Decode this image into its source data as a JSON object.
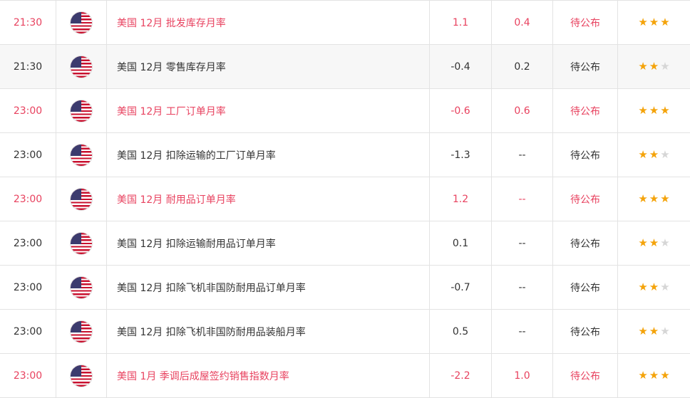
{
  "rows": [
    {
      "time": "21:30",
      "event": "美国 12月 批发库存月率",
      "previous": "1.1",
      "forecast": "0.4",
      "actual": "待公布",
      "stars": 3
    },
    {
      "time": "21:30",
      "event": "美国 12月 零售库存月率",
      "previous": "-0.4",
      "forecast": "0.2",
      "actual": "待公布",
      "stars": 2
    },
    {
      "time": "23:00",
      "event": "美国 12月 工厂订单月率",
      "previous": "-0.6",
      "forecast": "0.6",
      "actual": "待公布",
      "stars": 3
    },
    {
      "time": "23:00",
      "event": "美国 12月 扣除运输的工厂订单月率",
      "previous": "-1.3",
      "forecast": "--",
      "actual": "待公布",
      "stars": 2
    },
    {
      "time": "23:00",
      "event": "美国 12月 耐用品订单月率",
      "previous": "1.2",
      "forecast": "--",
      "actual": "待公布",
      "stars": 3
    },
    {
      "time": "23:00",
      "event": "美国 12月 扣除运输耐用品订单月率",
      "previous": "0.1",
      "forecast": "--",
      "actual": "待公布",
      "stars": 2
    },
    {
      "time": "23:00",
      "event": "美国 12月 扣除飞机非国防耐用品订单月率",
      "previous": "-0.7",
      "forecast": "--",
      "actual": "待公布",
      "stars": 2
    },
    {
      "time": "23:00",
      "event": "美国 12月 扣除飞机非国防耐用品装船月率",
      "previous": "0.5",
      "forecast": "--",
      "actual": "待公布",
      "stars": 2
    },
    {
      "time": "23:00",
      "event": "美国 1月 季调后成屋签约销售指数月率",
      "previous": "-2.2",
      "forecast": "1.0",
      "actual": "待公布",
      "stars": 3
    }
  ],
  "colors": {
    "highlight": "#e8425f",
    "text": "#333333",
    "star_on": "#f4a30a",
    "star_off": "#d6d6d6"
  },
  "icons": {
    "flag": "us-flag-icon",
    "star": "star-icon"
  }
}
